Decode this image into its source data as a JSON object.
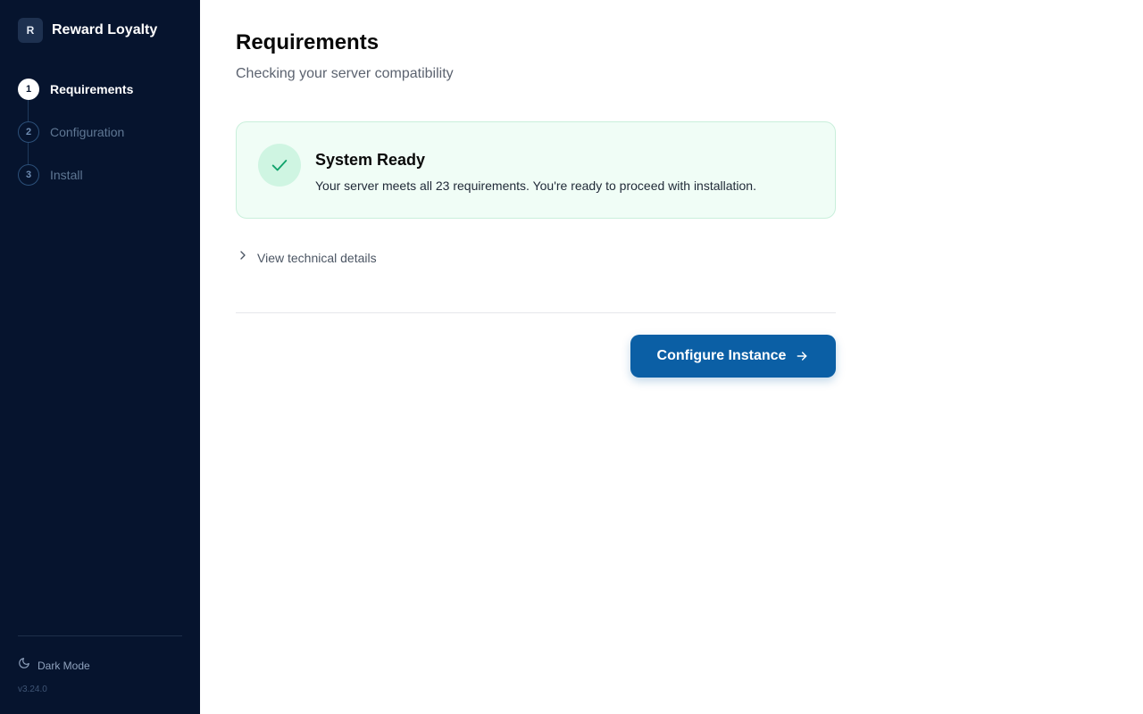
{
  "brand": {
    "logo_letter": "R",
    "name": "Reward Loyalty"
  },
  "steps": [
    {
      "number": "1",
      "label": "Requirements",
      "state": "active"
    },
    {
      "number": "2",
      "label": "Configuration",
      "state": "inactive"
    },
    {
      "number": "3",
      "label": "Install",
      "state": "inactive"
    }
  ],
  "sidebar_footer": {
    "dark_mode_label": "Dark Mode",
    "dark_mode_icon": "moon-icon",
    "version": "v3.24.0"
  },
  "page": {
    "title": "Requirements",
    "subtitle": "Checking your server compatibility"
  },
  "status": {
    "icon": "check-icon",
    "title": "System Ready",
    "description": "Your server meets all 23 requirements. You're ready to proceed with installation.",
    "colors": {
      "background": "#f0fdf6",
      "border": "#c9efdb",
      "icon_bg": "#cff5e2",
      "icon": "#10a36b"
    }
  },
  "details": {
    "icon": "chevron-right-icon",
    "label": "View technical details"
  },
  "actions": {
    "primary_label": "Configure Instance",
    "primary_icon": "arrow-right-icon",
    "primary_color": "#0b5fa5"
  },
  "colors": {
    "sidebar_bg": "#06142e",
    "accent": "#0b5fa5"
  }
}
